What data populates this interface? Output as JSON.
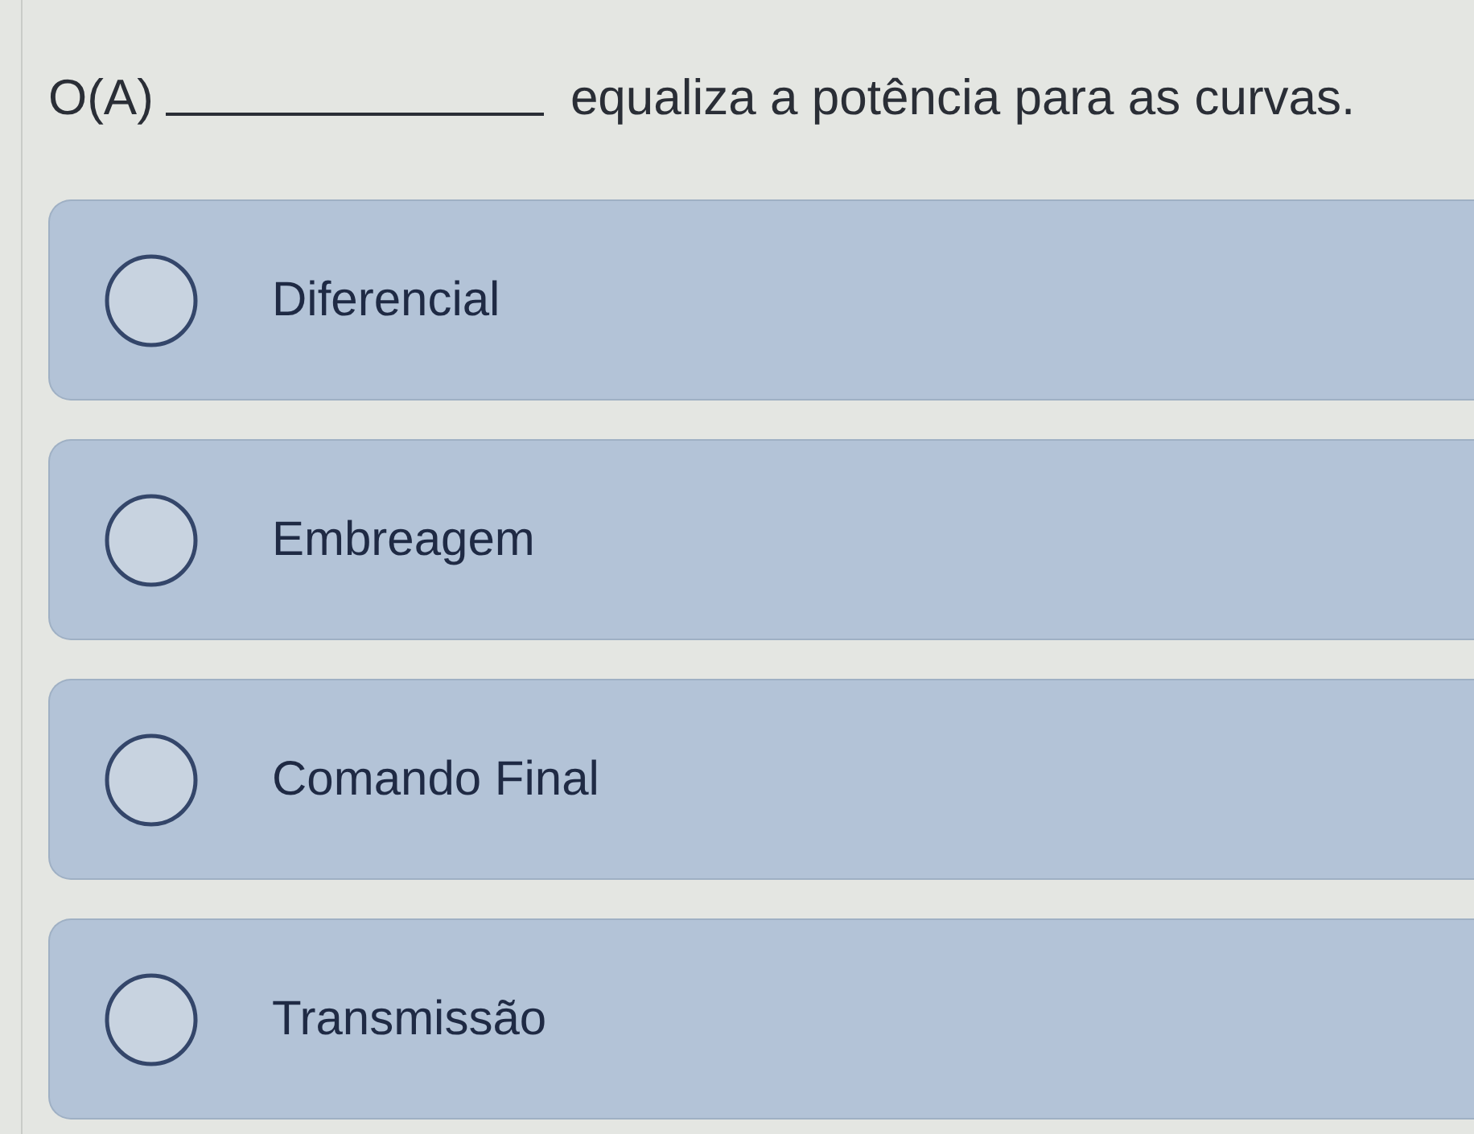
{
  "question": {
    "before": "O(A)",
    "after": "equaliza a potência para as curvas."
  },
  "options": [
    {
      "label": "Diferencial",
      "selected": false
    },
    {
      "label": "Embreagem",
      "selected": false
    },
    {
      "label": "Comando Final",
      "selected": false
    },
    {
      "label": "Transmissão",
      "selected": false
    }
  ]
}
